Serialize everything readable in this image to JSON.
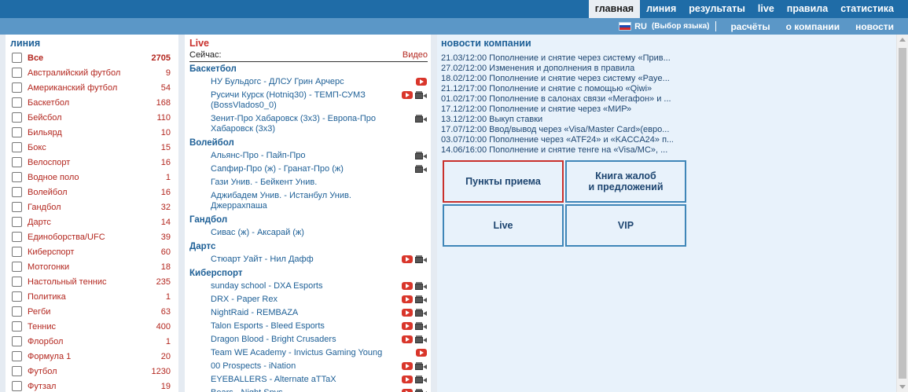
{
  "topnav": {
    "items": [
      "главная",
      "линия",
      "результаты",
      "live",
      "правила",
      "статистика"
    ]
  },
  "subnav": {
    "lang_code": "RU",
    "lang_choose": "(Выбор языка)",
    "items": [
      "расчёты",
      "о компании",
      "новости"
    ]
  },
  "line": {
    "title": "линия",
    "sports": [
      {
        "name": "Все",
        "count": "2705"
      },
      {
        "name": "Австралийский футбол",
        "count": "9"
      },
      {
        "name": "Американский футбол",
        "count": "54"
      },
      {
        "name": "Баскетбол",
        "count": "168"
      },
      {
        "name": "Бейсбол",
        "count": "110"
      },
      {
        "name": "Бильярд",
        "count": "10"
      },
      {
        "name": "Бокс",
        "count": "15"
      },
      {
        "name": "Велоспорт",
        "count": "16"
      },
      {
        "name": "Водное поло",
        "count": "1"
      },
      {
        "name": "Волейбол",
        "count": "16"
      },
      {
        "name": "Гандбол",
        "count": "32"
      },
      {
        "name": "Дартс",
        "count": "14"
      },
      {
        "name": "Единоборства/UFC",
        "count": "39"
      },
      {
        "name": "Киберспорт",
        "count": "60"
      },
      {
        "name": "Мотогонки",
        "count": "18"
      },
      {
        "name": "Настольный теннис",
        "count": "235"
      },
      {
        "name": "Политика",
        "count": "1"
      },
      {
        "name": "Регби",
        "count": "63"
      },
      {
        "name": "Теннис",
        "count": "400"
      },
      {
        "name": "Флорбол",
        "count": "1"
      },
      {
        "name": "Формула 1",
        "count": "20"
      },
      {
        "name": "Футбол",
        "count": "1230"
      },
      {
        "name": "Футзал",
        "count": "19"
      }
    ]
  },
  "live": {
    "title": "Live",
    "now_label": "Сейчас:",
    "video_label": "Видео",
    "groups": [
      {
        "name": "Баскетбол",
        "matches": [
          {
            "name": "НУ Бульдогс - ДЛСУ Грин Арчерс",
            "yt": true,
            "cam": false
          },
          {
            "name": "Русичи Курск (Hotniq30) - ТЕМП-СУМЗ (BossVlados0_0)",
            "yt": true,
            "cam": true
          },
          {
            "name": "Зенит-Про Хабаровск (3х3) - Европа-Про Хабаровск (3х3)",
            "yt": false,
            "cam": true
          }
        ]
      },
      {
        "name": "Волейбол",
        "matches": [
          {
            "name": "Альянс-Про - Пайп-Про",
            "yt": false,
            "cam": true
          },
          {
            "name": "Сапфир-Про (ж) - Гранат-Про (ж)",
            "yt": false,
            "cam": true
          },
          {
            "name": "Гази Унив. - Бейкент Унив.",
            "yt": false,
            "cam": false
          },
          {
            "name": "Аджибадем Унив. - Истанбул Унив. Джеррахпаша",
            "yt": false,
            "cam": false
          }
        ]
      },
      {
        "name": "Гандбол",
        "matches": [
          {
            "name": "Сивас (ж) - Аксарай (ж)",
            "yt": false,
            "cam": false
          }
        ]
      },
      {
        "name": "Дартс",
        "matches": [
          {
            "name": "Стюарт Уайт - Нил Дафф",
            "yt": true,
            "cam": true
          }
        ]
      },
      {
        "name": "Киберспорт",
        "matches": [
          {
            "name": "sunday school - DXA Esports",
            "yt": true,
            "cam": true
          },
          {
            "name": "DRX - Paper Rex",
            "yt": true,
            "cam": true
          },
          {
            "name": "NightRaid - REMBAZA",
            "yt": true,
            "cam": true
          },
          {
            "name": "Talon Esports - Bleed Esports",
            "yt": true,
            "cam": true
          },
          {
            "name": "Dragon Blood - Bright Crusaders",
            "yt": true,
            "cam": true
          },
          {
            "name": "Team WE Academy - Invictus Gaming Young",
            "yt": true,
            "cam": false
          },
          {
            "name": "00 Prospects - iNation",
            "yt": true,
            "cam": true
          },
          {
            "name": "EYEBALLERS - Alternate aTTaX",
            "yt": true,
            "cam": true
          },
          {
            "name": "Bears - Night Spys",
            "yt": true,
            "cam": true
          }
        ]
      }
    ]
  },
  "news": {
    "title": "новости компании",
    "items": [
      "21.03/12:00 Пополнение и снятие через систему «Прив...",
      "27.02/12:00 Изменения и дополнения в правила",
      "18.02/12:00 Пополнение и снятие через систему «Payе...",
      "21.12/17:00 Пополнение и снятие с помощью «Qiwi»",
      "01.02/17:00 Пополнение в салонах связи «Мегафон» и ...",
      "17.12/12:00 Пополнение и снятие через «МИР»",
      "13.12/12:00 Выкуп ставки",
      "17.07/12:00 Ввод/вывод через «Visa/Master Card»(евро...",
      "03.07/10:00 Пополнение через «ATF24» и «KACCA24» п...",
      "14.06/16:00 Пополнение и снятие тенге на «Visa/MC», ..."
    ],
    "tiles": {
      "points": "Пункты приема",
      "complaints_line1": "Книга жалоб",
      "complaints_line2": "и предложений",
      "live": "Live",
      "vip": "VIP"
    }
  },
  "colors": {
    "topbar": "#1f6ca7",
    "subbar": "#5b97c7",
    "sport_text": "#b3261e",
    "link_blue": "#1d5f96",
    "news_bg": "#e8f2fb",
    "tile_border": "#3f86b8",
    "tile_active_border": "#c9302c"
  }
}
